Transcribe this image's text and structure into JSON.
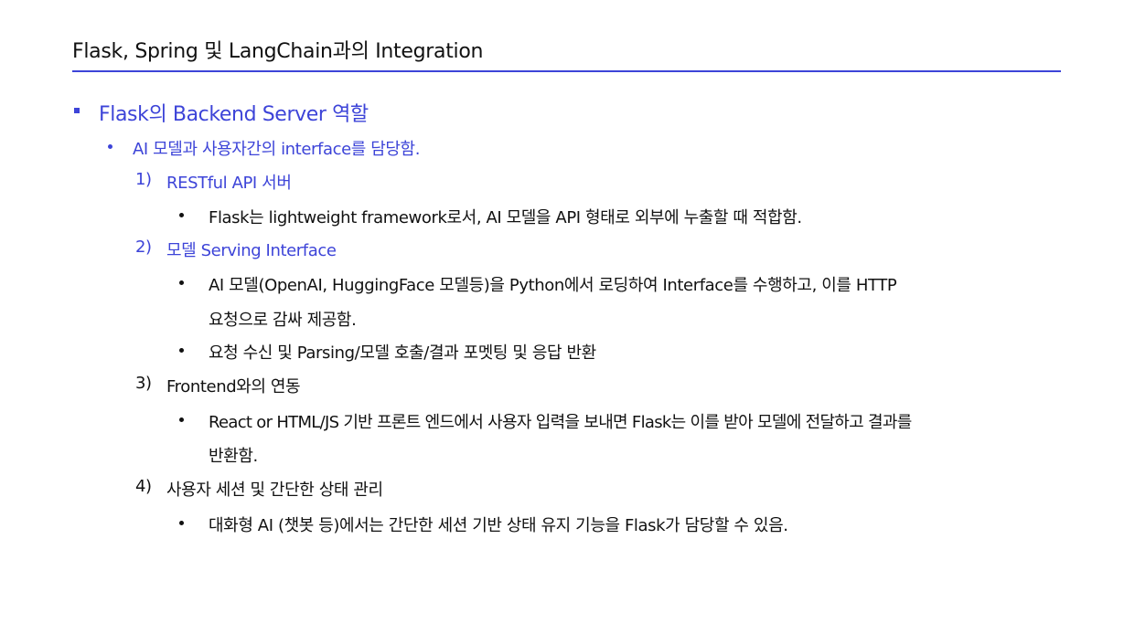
{
  "title": "Flask, Spring 및 LangChain과의 Integration",
  "accent_color": "#3d44d8",
  "section": {
    "heading": "Flask의 Backend Server 역할",
    "subpoint": "AI 모델과 사용자간의 interface를 담당함.",
    "items": [
      {
        "number": "1)",
        "label": "RESTful API 서버",
        "bullets": [
          [
            "Flask는 lightweight framework로서, AI 모델을 API 형태로 외부에 누출할 때 적합함."
          ]
        ]
      },
      {
        "number": "2)",
        "label": "모델 Serving Interface",
        "bullets": [
          [
            "AI 모델(OpenAI, HuggingFace 모델등)을 Python에서 로딩하여 Interface를 수행하고, 이를 HTTP",
            "요청으로 감싸 제공함."
          ],
          [
            "요청 수신 및 Parsing/모델 호출/결과 포멧팅 및 응답 반환"
          ]
        ]
      },
      {
        "number": "3)",
        "label": "Frontend와의 연동",
        "bullets": [
          [
            "React or HTML/JS 기반 프론트 엔드에서 사용자 입력을 보내면 Flask는 이를 받아 모델에 전달하고 결과를",
            "반환함."
          ]
        ]
      },
      {
        "number": "4)",
        "label": "사용자 세션 및 간단한 상태 관리",
        "bullets": [
          [
            "대화형 AI (챗봇 등)에서는 간단한 세션 기반 상태 유지 기능을 Flask가 담당할 수 있음."
          ]
        ]
      }
    ]
  }
}
